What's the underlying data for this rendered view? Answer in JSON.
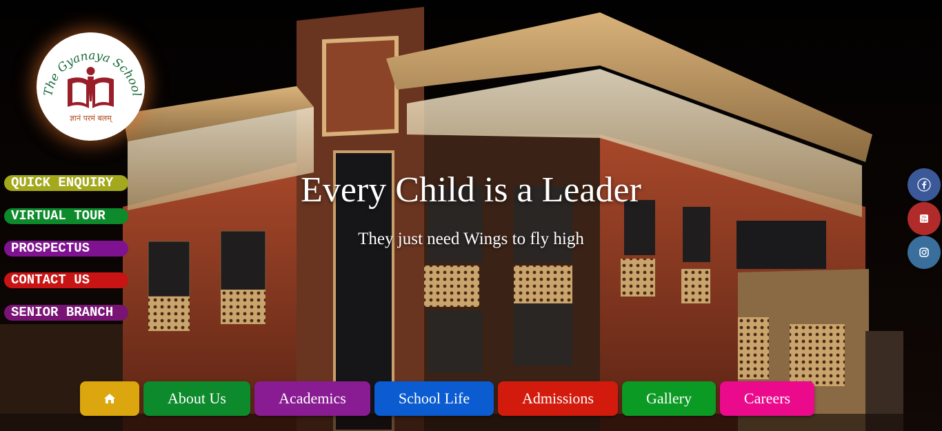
{
  "logo": {
    "name": "The Gyanaya School",
    "motto": "ज्ञानं परमं बलम्"
  },
  "side_links": [
    {
      "label": "QUICK ENQUIRY",
      "color": "#a3a81c"
    },
    {
      "label": "VIRTUAL TOUR",
      "color": "#0d8a2b"
    },
    {
      "label": "PROSPECTUS",
      "color": "#7f1290"
    },
    {
      "label": "CONTACT US",
      "color": "#c81414"
    },
    {
      "label": "SENIOR BRANCH",
      "color": "#7a1474"
    }
  ],
  "hero": {
    "title": "Every Child is a Leader",
    "subtitle": "They just need Wings to fly high"
  },
  "social": [
    {
      "icon": "facebook-icon",
      "color": "#3b5998"
    },
    {
      "icon": "youtube-icon",
      "color": "#b22b2b"
    },
    {
      "icon": "instagram-icon",
      "color": "#3a6e9c"
    }
  ],
  "nav": {
    "home": {
      "icon": "home-icon",
      "color": "#dca70e"
    },
    "items": [
      {
        "label": "About Us",
        "color": "#0d8a2b"
      },
      {
        "label": "Academics",
        "color": "#8a1c93"
      },
      {
        "label": "School Life",
        "color": "#0b5bd1"
      },
      {
        "label": "Admissions",
        "color": "#d21b0d"
      },
      {
        "label": "Gallery",
        "color": "#0b9a23"
      },
      {
        "label": "Careers",
        "color": "#ea0a8b"
      }
    ]
  }
}
